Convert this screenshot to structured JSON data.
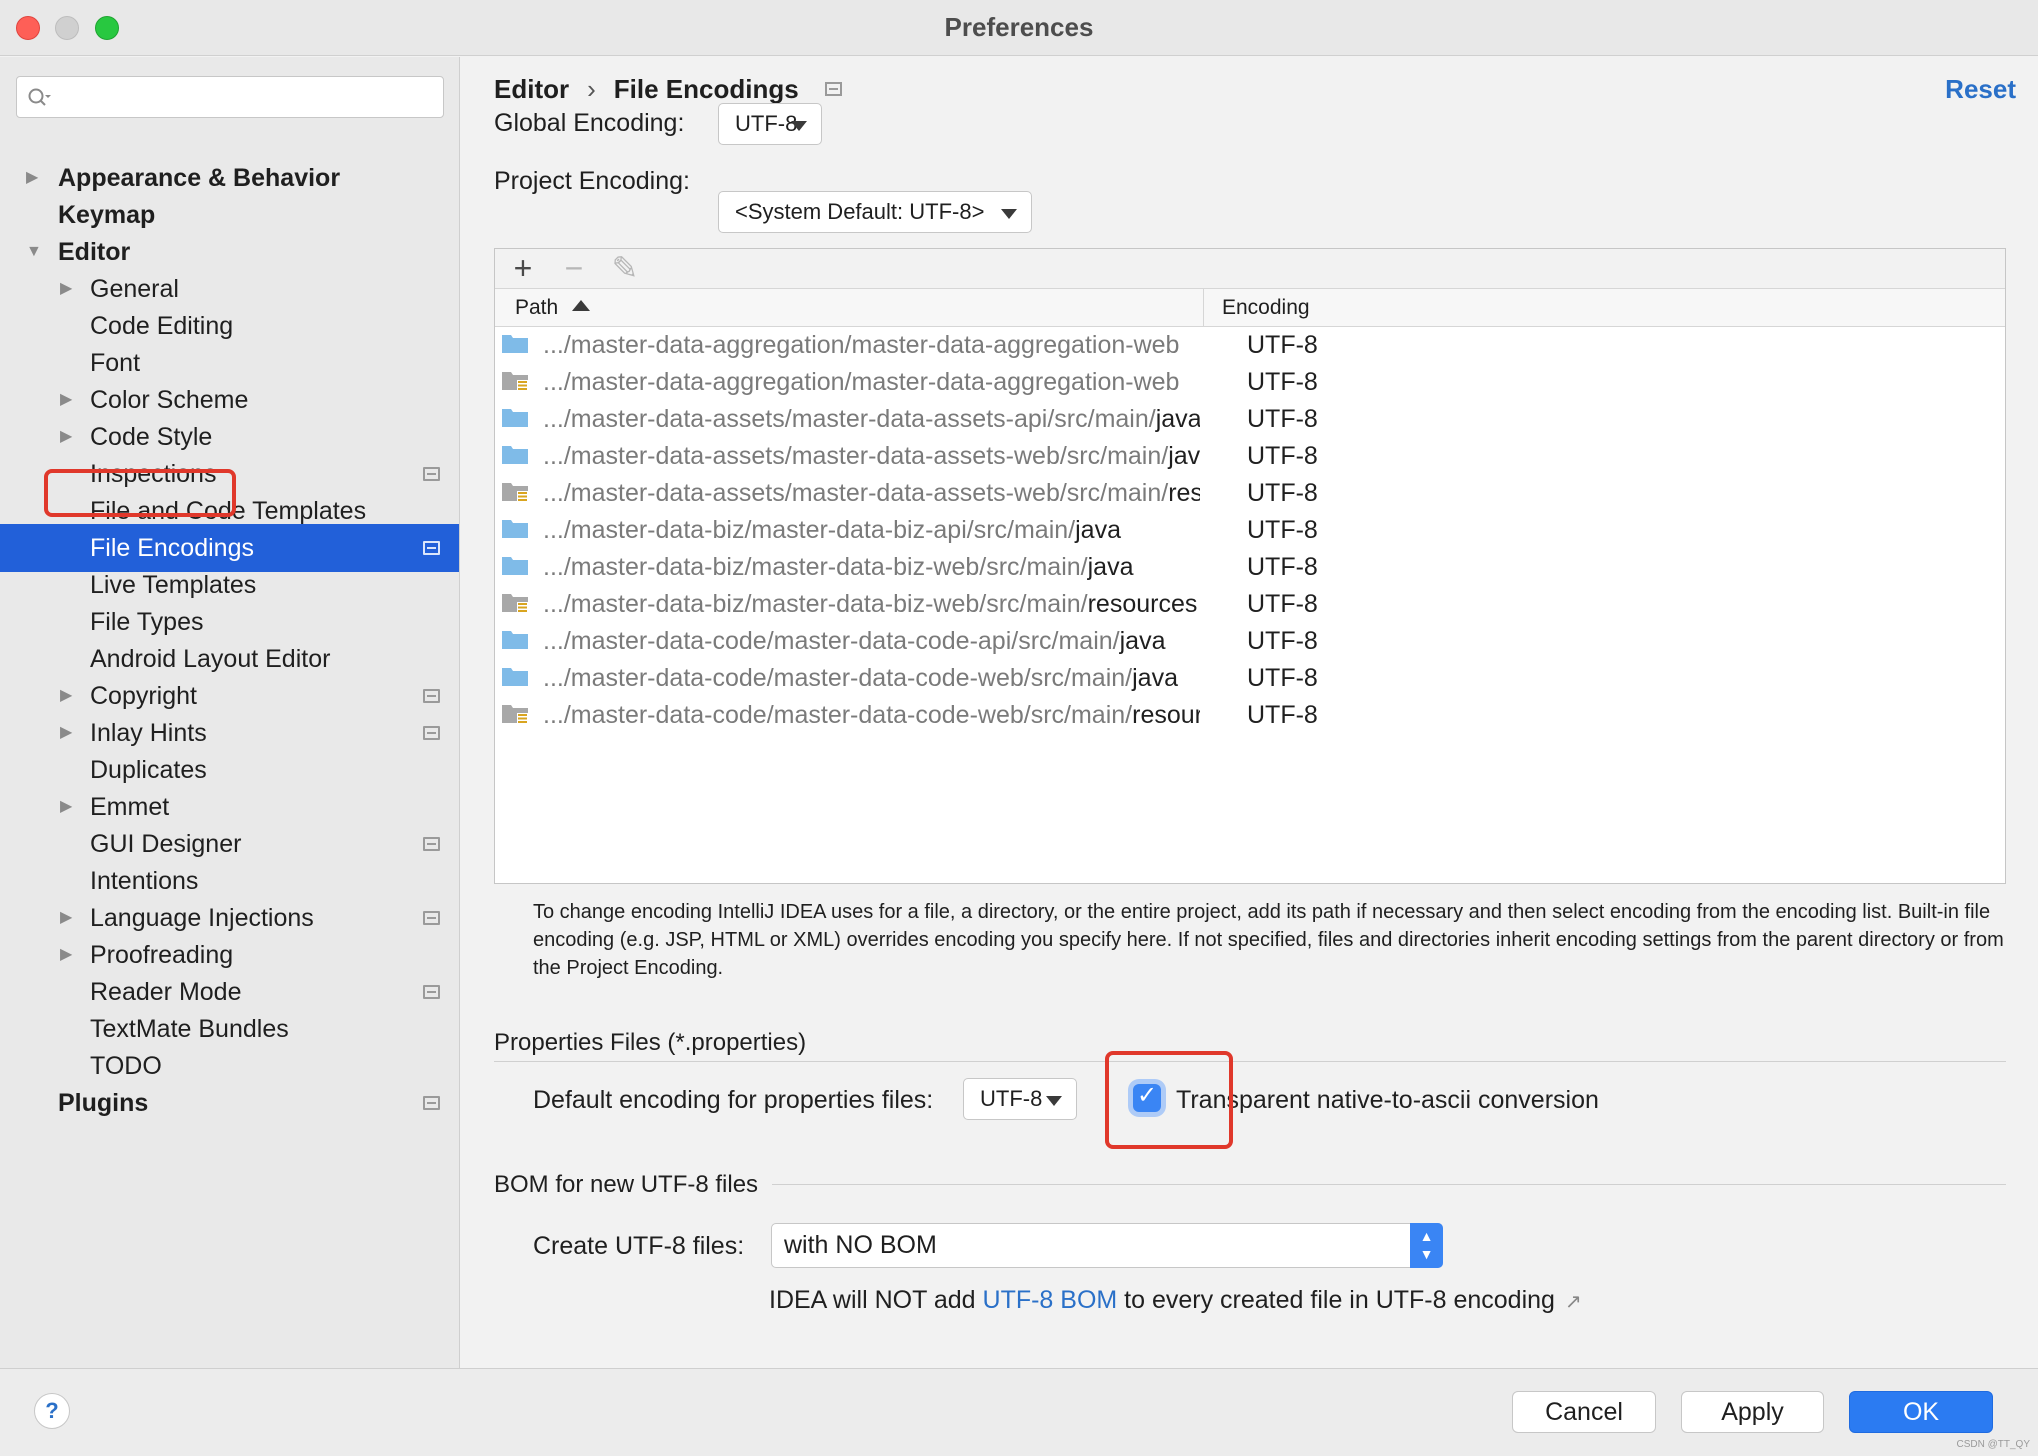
{
  "window": {
    "title": "Preferences"
  },
  "sidebar": {
    "search_placeholder": "",
    "items": [
      {
        "label": "Appearance & Behavior",
        "level": "top",
        "arrow": "right",
        "proj": false
      },
      {
        "label": "Keymap",
        "level": "top",
        "arrow": "",
        "proj": false
      },
      {
        "label": "Editor",
        "level": "top",
        "arrow": "down",
        "proj": false
      },
      {
        "label": "General",
        "level": "child",
        "arrow": "right",
        "proj": false
      },
      {
        "label": "Code Editing",
        "level": "child",
        "arrow": "",
        "proj": false
      },
      {
        "label": "Font",
        "level": "child",
        "arrow": "",
        "proj": false
      },
      {
        "label": "Color Scheme",
        "level": "child",
        "arrow": "right",
        "proj": false
      },
      {
        "label": "Code Style",
        "level": "child",
        "arrow": "right",
        "proj": false
      },
      {
        "label": "Inspections",
        "level": "child",
        "arrow": "",
        "proj": true
      },
      {
        "label": "File and Code Templates",
        "level": "child",
        "arrow": "",
        "proj": false
      },
      {
        "label": "File Encodings",
        "level": "child",
        "arrow": "",
        "proj": true,
        "selected": true
      },
      {
        "label": "Live Templates",
        "level": "child",
        "arrow": "",
        "proj": false
      },
      {
        "label": "File Types",
        "level": "child",
        "arrow": "",
        "proj": false
      },
      {
        "label": "Android Layout Editor",
        "level": "child",
        "arrow": "",
        "proj": false
      },
      {
        "label": "Copyright",
        "level": "child",
        "arrow": "right",
        "proj": true
      },
      {
        "label": "Inlay Hints",
        "level": "child",
        "arrow": "right",
        "proj": true
      },
      {
        "label": "Duplicates",
        "level": "child",
        "arrow": "",
        "proj": false
      },
      {
        "label": "Emmet",
        "level": "child",
        "arrow": "right",
        "proj": false
      },
      {
        "label": "GUI Designer",
        "level": "child",
        "arrow": "",
        "proj": true
      },
      {
        "label": "Intentions",
        "level": "child",
        "arrow": "",
        "proj": false
      },
      {
        "label": "Language Injections",
        "level": "child",
        "arrow": "right",
        "proj": true
      },
      {
        "label": "Proofreading",
        "level": "child",
        "arrow": "right",
        "proj": false
      },
      {
        "label": "Reader Mode",
        "level": "child",
        "arrow": "",
        "proj": true
      },
      {
        "label": "TextMate Bundles",
        "level": "child",
        "arrow": "",
        "proj": false
      },
      {
        "label": "TODO",
        "level": "child",
        "arrow": "",
        "proj": false
      },
      {
        "label": "Plugins",
        "level": "top",
        "arrow": "",
        "proj": true
      }
    ]
  },
  "main": {
    "breadcrumb": {
      "parent": "Editor",
      "separator": "›",
      "current": "File Encodings"
    },
    "reset_label": "Reset",
    "global_encoding": {
      "label": "Global Encoding:",
      "value": "UTF-8"
    },
    "project_encoding": {
      "label": "Project Encoding:",
      "value": "<System Default: UTF-8>"
    },
    "table": {
      "toolbar": {
        "add": "+",
        "remove": "−",
        "edit": "✎"
      },
      "col_path": "Path",
      "col_encoding": "Encoding",
      "rows": [
        {
          "path": ".../master-data-aggregation/master-data-aggregation-web",
          "tail": "",
          "encoding": "UTF-8",
          "icon": "folder-source"
        },
        {
          "path": ".../master-data-aggregation/master-data-aggregation-web",
          "tail": "",
          "encoding": "UTF-8",
          "icon": "folder-resource"
        },
        {
          "path": ".../master-data-assets/master-data-assets-api/src/main/",
          "tail": "java",
          "encoding": "UTF-8",
          "icon": "folder-source"
        },
        {
          "path": ".../master-data-assets/master-data-assets-web/src/main/",
          "tail": "java",
          "encoding": "UTF-8",
          "icon": "folder-source"
        },
        {
          "path": ".../master-data-assets/master-data-assets-web/src/main/",
          "tail": "resources",
          "encoding": "UTF-8",
          "icon": "folder-resource"
        },
        {
          "path": ".../master-data-biz/master-data-biz-api/src/main/",
          "tail": "java",
          "encoding": "UTF-8",
          "icon": "folder-source"
        },
        {
          "path": ".../master-data-biz/master-data-biz-web/src/main/",
          "tail": "java",
          "encoding": "UTF-8",
          "icon": "folder-source"
        },
        {
          "path": ".../master-data-biz/master-data-biz-web/src/main/",
          "tail": "resources",
          "encoding": "UTF-8",
          "icon": "folder-resource"
        },
        {
          "path": ".../master-data-code/master-data-code-api/src/main/",
          "tail": "java",
          "encoding": "UTF-8",
          "icon": "folder-source"
        },
        {
          "path": ".../master-data-code/master-data-code-web/src/main/",
          "tail": "java",
          "encoding": "UTF-8",
          "icon": "folder-source"
        },
        {
          "path": ".../master-data-code/master-data-code-web/src/main/",
          "tail": "resources",
          "encoding": "UTF-8",
          "icon": "folder-resource"
        }
      ]
    },
    "help_text": "To change encoding IntelliJ IDEA uses for a file, a directory, or the entire project, add its path if necessary and then select encoding from the encoding list. Built-in file encoding (e.g. JSP, HTML or XML) overrides encoding you specify here. If not specified, files and directories inherit encoding settings from the parent directory or from the Project Encoding.",
    "properties_section": {
      "title": "Properties Files (*.properties)",
      "default_label": "Default encoding for properties files:",
      "default_value": "UTF-8",
      "checkbox_label": "Transparent native-to-ascii conversion",
      "checked": true
    },
    "bom_section": {
      "title": "BOM for new UTF-8 files",
      "create_label": "Create UTF-8 files:",
      "create_value": "with NO BOM",
      "note_prefix": "IDEA will NOT add ",
      "note_link": "UTF-8 BOM",
      "note_suffix": " to every created file in UTF-8 encoding",
      "note_icon": "↗"
    }
  },
  "footer": {
    "help": "?",
    "cancel": "Cancel",
    "apply": "Apply",
    "ok": "OK",
    "watermark": "CSDN @TT_QY"
  },
  "colors": {
    "selection": "#2260d9",
    "accent": "#2b7bf2",
    "link": "#2a70c8",
    "highlight_box": "#e0382b",
    "folder_source": "#7fbbe8",
    "folder_resource": "#a8a8a8"
  }
}
